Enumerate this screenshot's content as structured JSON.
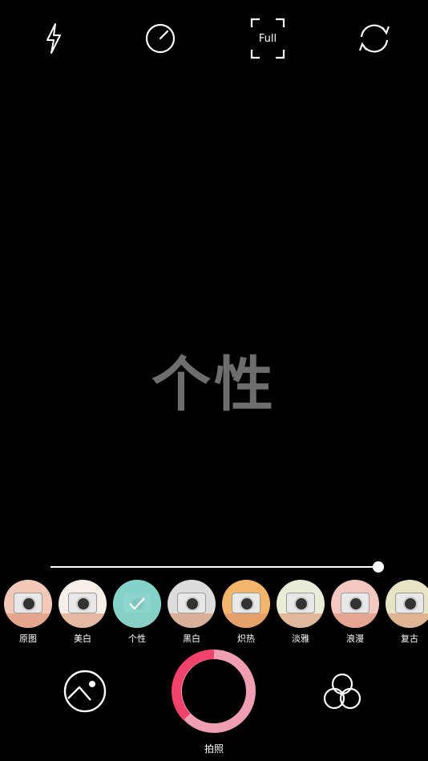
{
  "top_bar": {
    "flash_icon": "flash-icon",
    "timer_icon": "timer-icon",
    "aspect_label": "Full",
    "switch_camera_icon": "switch-camera-icon"
  },
  "preview": {
    "filter_name": "个性"
  },
  "slider": {
    "value_percent": 100
  },
  "filters": [
    {
      "label": "原图",
      "tint": "#f2c8b8"
    },
    {
      "label": "美白",
      "tint": "#f6efe9"
    },
    {
      "label": "个性",
      "tint": "#85d3c9",
      "selected": true
    },
    {
      "label": "黑白",
      "tint": "#dcdcdc"
    },
    {
      "label": "炽热",
      "tint": "#f2b56a"
    },
    {
      "label": "淡雅",
      "tint": "#e9edd8"
    },
    {
      "label": "浪漫",
      "tint": "#f4c7c1"
    },
    {
      "label": "复古",
      "tint": "#e7e4c6"
    }
  ],
  "bottom_bar": {
    "gallery_icon": "gallery-icon",
    "shutter_label": "拍照",
    "effects_icon": "effects-icon"
  },
  "colors": {
    "shutter_ring": "#f0426a",
    "shutter_ring_light": "#ef9fb1",
    "selected_filter": "#85d3c9"
  }
}
